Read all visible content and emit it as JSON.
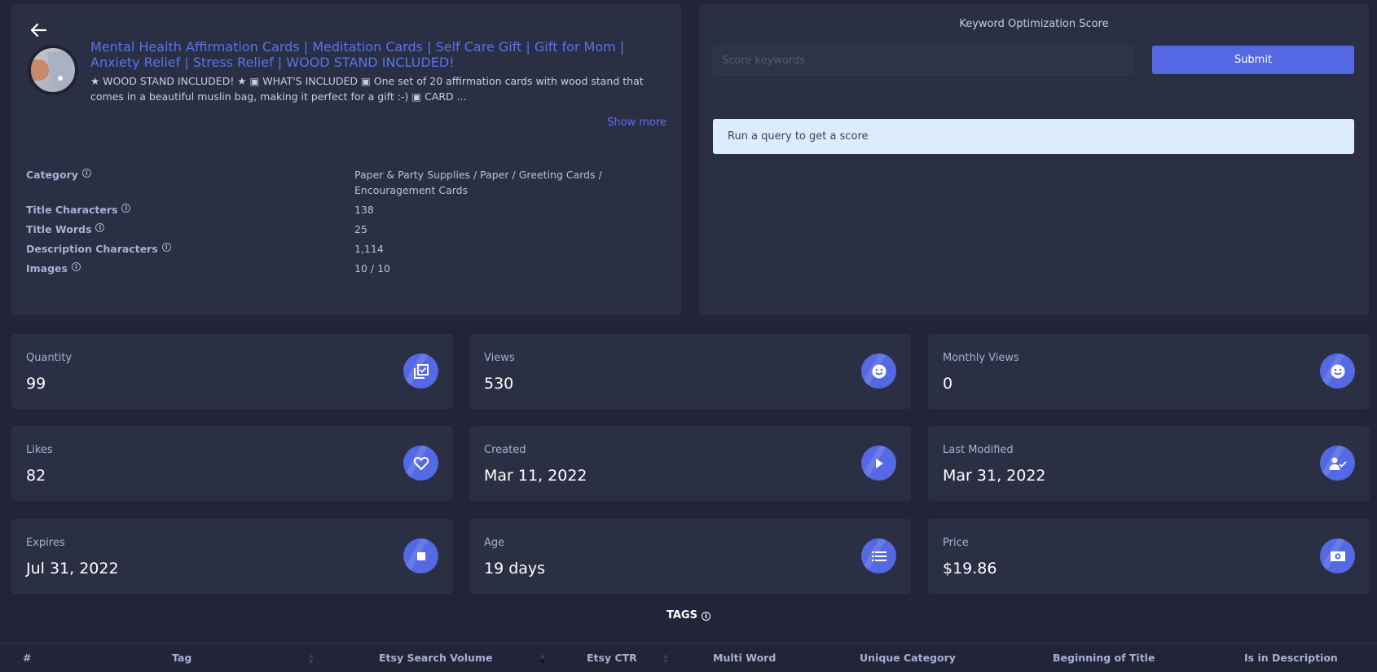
{
  "listing": {
    "back_icon": "arrow-left-icon",
    "title": "Mental Health Affirmation Cards | Meditation Cards | Self Care Gift | Gift for Mom | Anxiety Relief | Stress Relief | WOOD STAND INCLUDED!",
    "description": "★ WOOD STAND INCLUDED! ★ ▣ WHAT'S INCLUDED ▣ One set of 20 affirmation cards with wood stand that comes in a beautiful muslin bag, making it perfect for a gift :-) ▣ CARD ...",
    "show_more_label": "Show more",
    "details": [
      {
        "label": "Category",
        "value": "Paper & Party Supplies / Paper / Greeting Cards / Encouragement Cards"
      },
      {
        "label": "Title Characters",
        "value": "138"
      },
      {
        "label": "Title Words",
        "value": "25"
      },
      {
        "label": "Description Characters",
        "value": "1,114"
      },
      {
        "label": "Images",
        "value": "10 / 10"
      }
    ]
  },
  "keyword_score": {
    "title": "Keyword Optimization Score",
    "input_placeholder": "Score keywords",
    "input_value": "",
    "submit_label": "Submit",
    "alert_text": "Run a query to get a score"
  },
  "stats": [
    {
      "label": "Quantity",
      "value": "99",
      "icon": "copy-check-icon"
    },
    {
      "label": "Views",
      "value": "530",
      "icon": "smiley-icon"
    },
    {
      "label": "Monthly Views",
      "value": "0",
      "icon": "smiley-icon"
    },
    {
      "label": "Likes",
      "value": "82",
      "icon": "heart-icon"
    },
    {
      "label": "Created",
      "value": "Mar 11, 2022",
      "icon": "play-icon"
    },
    {
      "label": "Last Modified",
      "value": "Mar 31, 2022",
      "icon": "user-check-icon"
    },
    {
      "label": "Expires",
      "value": "Jul 31, 2022",
      "icon": "stop-icon"
    },
    {
      "label": "Age",
      "value": "19 days",
      "icon": "list-icon"
    },
    {
      "label": "Price",
      "value": "$19.86",
      "icon": "money-icon"
    }
  ],
  "tags": {
    "title": "TAGS",
    "columns": [
      {
        "label": "#",
        "sortable": false
      },
      {
        "label": "Tag",
        "sortable": true
      },
      {
        "label": "Etsy Search Volume",
        "sortable": true
      },
      {
        "label": "Etsy CTR",
        "sortable": true
      },
      {
        "label": "Multi Word",
        "sortable": false
      },
      {
        "label": "Unique Category",
        "sortable": false
      },
      {
        "label": "Beginning of Title",
        "sortable": false
      },
      {
        "label": "Is in Description",
        "sortable": false
      }
    ]
  },
  "colors": {
    "accent": "#5469e3",
    "link": "#5a72ee",
    "background": "#222537",
    "panel": "#2a2f43",
    "alert_bg": "#dcecfb"
  }
}
